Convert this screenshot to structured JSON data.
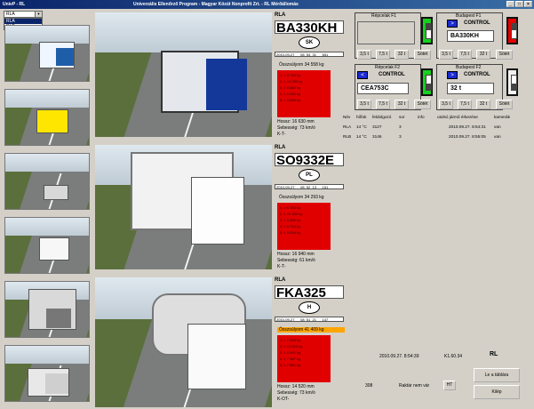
{
  "window": {
    "app_title": "UnivP - RL",
    "caption": "Univerzális Ellenőrző Program  -  Magyar Közút Nonprofit Zrt.  -  RL Mérőállomás",
    "buttons": [
      "_",
      "□",
      "×"
    ]
  },
  "station_select": {
    "selected": "RLA",
    "options": [
      "RLA",
      "RLB"
    ]
  },
  "thumbs": [
    "lane-camera-1",
    "lane-camera-2",
    "lane-camera-3",
    "lane-camera-4",
    "lane-camera-5",
    "lane-camera-6"
  ],
  "vehicles": [
    {
      "lane": "RLA",
      "plate": "BA330KH",
      "country": "SK",
      "file": "2010-09-27___08_54_31___651",
      "total": "Összsúlyom 34 558 kg",
      "axles": [
        "1. t:   4 745 kg",
        "2. t: 10 283 kg",
        "3. t:   6 883 kg",
        "4. t:   6 045 kg",
        "5. t:   6 069 kg"
      ],
      "length": "Hossz:  16 630 mm",
      "speed": "Sebesség:  73 km/ó",
      "code": "K-T-"
    },
    {
      "lane": "RLA",
      "plate": "SO9332E",
      "country": "PL",
      "file": "2010-09-27___08_52_13___151",
      "total": "Összsúlyom 34 293 kg",
      "axles": [
        "1. t:   6 753 kg",
        "2. t: 10 153 kg",
        "3. t:   5 489 kg",
        "4. t:   5 710 kg",
        "5. t:   5 916 kg"
      ],
      "length": "Hossz:  16 940 mm",
      "speed": "Sebesség:  61 km/ó",
      "code": "K-T-"
    },
    {
      "lane": "RLA",
      "plate": "FKA325",
      "country": "H",
      "file": "2010-09-27___08_51_21___147",
      "total": "Összsúlyom 41 409 kg",
      "axles": [
        "1. t:   7 349 kg",
        "2. t: 10 823 kg",
        "3. t:   6 993 kg",
        "4. t:   7 387 kg",
        "5. t:   7 584 kg"
      ],
      "length": "Hossz:  14 520 mm",
      "speed": "Sebesség:  73 km/ó",
      "code": "K-OT-"
    }
  ],
  "controls": {
    "repeat_f1": "Répcelak F1",
    "budapest_f1": "Budapest F1",
    "repeat_f2": "Répcelak F2",
    "budapest_f2": "Budapest F2",
    "control_label": "CONTROL",
    "f1_plate": "BA330KH",
    "f2_plate": "CEA753C",
    "f2_weight": "32 t",
    "weight_buttons": [
      "3,5 t",
      "7,5 t",
      "32 t",
      "Sötét"
    ]
  },
  "table": {
    "headers": [
      "Név",
      "hőfok",
      "feldolgozó",
      "sor",
      "info",
      "utolsó jármű érkezése",
      "kamerák"
    ],
    "rows": [
      [
        "RLA",
        "14 °C",
        "3127",
        "3",
        "2010.09.27. 8:54:31",
        "van"
      ],
      [
        "RLB",
        "14 °C",
        "3146",
        "3",
        "2010.09.27. 8:55:05",
        "van"
      ]
    ]
  },
  "status": {
    "datetime": "2010.09.27. 8:54:39",
    "version": "K1.60.34",
    "station": "RL",
    "count": "308",
    "storage": "Raktár nem vár",
    "ht": "HT",
    "open_button": "Le a táblára",
    "exit_button": "Kilép"
  }
}
